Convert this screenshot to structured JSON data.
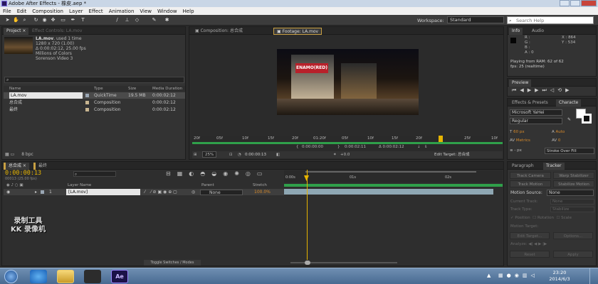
{
  "window": {
    "title": "Adobe After Effects - 橡皮.aep *"
  },
  "menu": [
    "File",
    "Edit",
    "Composition",
    "Layer",
    "Effect",
    "Animation",
    "View",
    "Window",
    "Help"
  ],
  "workspace": {
    "label": "Workspace:",
    "value": "Standard"
  },
  "search_help": {
    "placeholder": "Search Help"
  },
  "project": {
    "tabs": [
      "Project ×",
      "Effect Controls: LA.mov"
    ],
    "item": {
      "name": "LA.mov",
      "used": ", used 1 time",
      "res": "1280 x 720 (1.00)",
      "duration": "Δ 0:00:02:12, 25.00 fps",
      "colors": "Millions of Colors",
      "codec": "Sorenson Video 3"
    },
    "columns": [
      "Name",
      "Type",
      "Size",
      "Media Duration"
    ],
    "rows": [
      {
        "name": "LA.mov",
        "type": "QuickTime",
        "size": "19.5 MB",
        "dur": "0:00:02:12",
        "color": "#9aa6b4"
      },
      {
        "name": "总合成",
        "type": "Composition",
        "size": "",
        "dur": "0:00:02:12",
        "color": "#c8b590"
      },
      {
        "name": "最终",
        "type": "Composition",
        "size": "",
        "dur": "0:00:02:12",
        "color": "#c8b590"
      }
    ],
    "bpc": "8 bpc"
  },
  "viewer": {
    "tabs": [
      "Composition: 总合成",
      "Footage: LA.mov"
    ],
    "sign": "ENAMO(RED)",
    "ruler": [
      "20f",
      "05f",
      "10f",
      "15f",
      "20f",
      "01:20f",
      "05f",
      "10f",
      "15f",
      "20f",
      "25f",
      "10f"
    ],
    "time_in": "0:00:00:00",
    "time_out": "0:00:02:11",
    "time_dur": "Δ 0:00:02:12",
    "zoom": "25%",
    "current": "0:00:00:13",
    "offset": "+0.0",
    "edit_target": "Edit Target: 总合成"
  },
  "info": {
    "tabs": [
      "Info",
      "Audio"
    ],
    "r": "R :",
    "g": "G :",
    "b": "B :",
    "a": "A : 0",
    "x": "X : 864",
    "y": "Y : 534",
    "status1": "Playing from RAM: 62 of 62",
    "status2": "fps: 25 (realtime)"
  },
  "preview": {
    "tab": "Preview"
  },
  "character": {
    "tabs": [
      "Effects & Presets",
      "Characte"
    ],
    "font": "Microsoft YaHei",
    "style": "Regular",
    "size": "60 px",
    "leading": "Auto",
    "tracking": "0",
    "metrics": "Metrics",
    "stroke_w": "- px",
    "stroke_type": "Stroke Over Fill"
  },
  "tracker": {
    "tabs": [
      "Paragraph",
      "Tracker"
    ],
    "buttons": [
      "Track Camera",
      "Warp Stabilizer",
      "Track Motion",
      "Stabilize Motion"
    ],
    "motion_source_label": "Motion Source:",
    "motion_source": "None",
    "current_track_label": "Current Track:",
    "current_track": "None",
    "track_type_label": "Track Type:",
    "track_type": "Stabilize",
    "position": "Position",
    "rotation": "Rotation",
    "scale": "Scale",
    "motion_target": "Motion Target:",
    "edit_target": "Edit Target...",
    "options": "Options...",
    "analyze": "Analyze:",
    "reset": "Reset",
    "apply": "Apply"
  },
  "timeline": {
    "tabs": [
      "总合成 ×",
      "最终"
    ],
    "current_time": "0:00:00:13",
    "frame_info": "00013 (25.00 fps)",
    "columns": {
      "layer_name": "Layer Name",
      "parent": "Parent",
      "stretch": "Stretch"
    },
    "layer": {
      "num": "1",
      "name": "[LA.mov]",
      "parent": "None",
      "stretch": "100.0%"
    },
    "ruler": [
      "0:00s",
      "01s",
      "02s"
    ],
    "toggle": "Toggle Switches / Modes"
  },
  "watermark": {
    "line1": "录制工具",
    "line2": "KK 录像机"
  },
  "taskbar": {
    "time": "23:20",
    "date": "2014/6/3"
  }
}
